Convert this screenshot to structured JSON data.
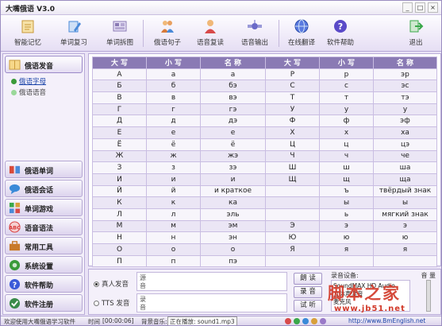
{
  "app": {
    "title": "大嘴俄语 V3.0"
  },
  "toolbar": {
    "items": [
      {
        "label": "智能记忆",
        "icon": "notepad-icon",
        "color": "#e8b84a"
      },
      {
        "label": "单词复习",
        "icon": "pen-icon",
        "color": "#4a8ad8"
      },
      {
        "label": "单词拆图",
        "icon": "picture-icon",
        "color": "#8a7ab4"
      },
      {
        "label": "俄语句子",
        "icon": "people-icon",
        "color": "#d87a3a"
      },
      {
        "label": "语音复读",
        "icon": "person-icon",
        "color": "#d84a4a"
      },
      {
        "label": "语音输出",
        "icon": "satellite-icon",
        "color": "#6a6ac8"
      },
      {
        "label": "在线翻译",
        "icon": "globe-icon",
        "color": "#4a6ad8"
      },
      {
        "label": "软件帮助",
        "icon": "help-icon",
        "color": "#5a4ac8"
      },
      {
        "label": "退出",
        "icon": "exit-icon",
        "color": "#3aa84a"
      }
    ]
  },
  "sidebar": {
    "top": {
      "label": "俄语发音",
      "icon": "book-icon",
      "color": "#d8a03a"
    },
    "sub": [
      {
        "label": "俄语字母",
        "color": "#3a9a3a"
      },
      {
        "label": "俄语语音",
        "color": "#9ad89a"
      }
    ],
    "items": [
      {
        "label": "俄语单词",
        "icon": "word-icon",
        "color": "#d84a3a"
      },
      {
        "label": "俄语会话",
        "icon": "chat-icon",
        "color": "#3a8ad8"
      },
      {
        "label": "单词游戏",
        "icon": "game-icon",
        "color": "#3aa84a"
      },
      {
        "label": "语音语法",
        "icon": "abc-icon",
        "color": "#d83a3a"
      },
      {
        "label": "常用工具",
        "icon": "toolbox-icon",
        "color": "#c87a2a"
      },
      {
        "label": "系统设置",
        "icon": "settings-icon",
        "color": "#3a9a3a"
      },
      {
        "label": "软件帮助",
        "icon": "help-icon",
        "color": "#3a5ad8"
      },
      {
        "label": "软件注册",
        "icon": "register-icon",
        "color": "#3a8a4a"
      }
    ]
  },
  "table": {
    "headers": [
      "大 写",
      "小 写",
      "名 称",
      "大 写",
      "小 写",
      "名 称"
    ],
    "rows": [
      [
        "А",
        "а",
        "а",
        "Р",
        "р",
        "эр"
      ],
      [
        "Б",
        "б",
        "бэ",
        "С",
        "с",
        "эс"
      ],
      [
        "В",
        "в",
        "вэ",
        "Т",
        "т",
        "тэ"
      ],
      [
        "Г",
        "г",
        "гэ",
        "У",
        "у",
        "у"
      ],
      [
        "Д",
        "д",
        "дэ",
        "Ф",
        "ф",
        "эф"
      ],
      [
        "Е",
        "е",
        "е",
        "Х",
        "х",
        "ха"
      ],
      [
        "Ё",
        "ё",
        "ё",
        "Ц",
        "ц",
        "цэ"
      ],
      [
        "Ж",
        "ж",
        "жэ",
        "Ч",
        "ч",
        "че"
      ],
      [
        "З",
        "з",
        "зэ",
        "Ш",
        "ш",
        "ша"
      ],
      [
        "И",
        "и",
        "и",
        "Щ",
        "щ",
        "ща"
      ],
      [
        "Й",
        "й",
        "и краткое",
        "",
        "ъ",
        "твёрдый знак"
      ],
      [
        "К",
        "к",
        "ка",
        "",
        "ы",
        "ы"
      ],
      [
        "Л",
        "л",
        "эль",
        "",
        "ь",
        "мягкий знак"
      ],
      [
        "М",
        "м",
        "эм",
        "Э",
        "э",
        "э"
      ],
      [
        "Н",
        "н",
        "эн",
        "Ю",
        "ю",
        "ю"
      ],
      [
        "О",
        "о",
        "о",
        "Я",
        "я",
        "я"
      ],
      [
        "П",
        "п",
        "пэ",
        "",
        "",
        ""
      ]
    ]
  },
  "bottom": {
    "radio_real": "真人发音",
    "radio_tts": "TTS 发音",
    "box1_label": "源音",
    "box2_label": "录音",
    "btn_read": "朗 读",
    "btn_record": "录 音",
    "btn_listen": "试 听",
    "device_label": "录音设备:",
    "volume_label": "音 量",
    "device_lines": [
      "SoundMAX HD Audio",
      "立体声混音",
      "麦克风"
    ]
  },
  "watermark": {
    "line1": "脚本之家",
    "line2": "www.jb51.net"
  },
  "status": {
    "welcome": "欢迎使用大嘴俄语学习软件",
    "time_label": "时间",
    "time_value": "[00:00:06]",
    "music_label": "背景音乐:",
    "playing": "正在播放: sound1.mp3",
    "url": "http://www.BmEnglish.net"
  }
}
